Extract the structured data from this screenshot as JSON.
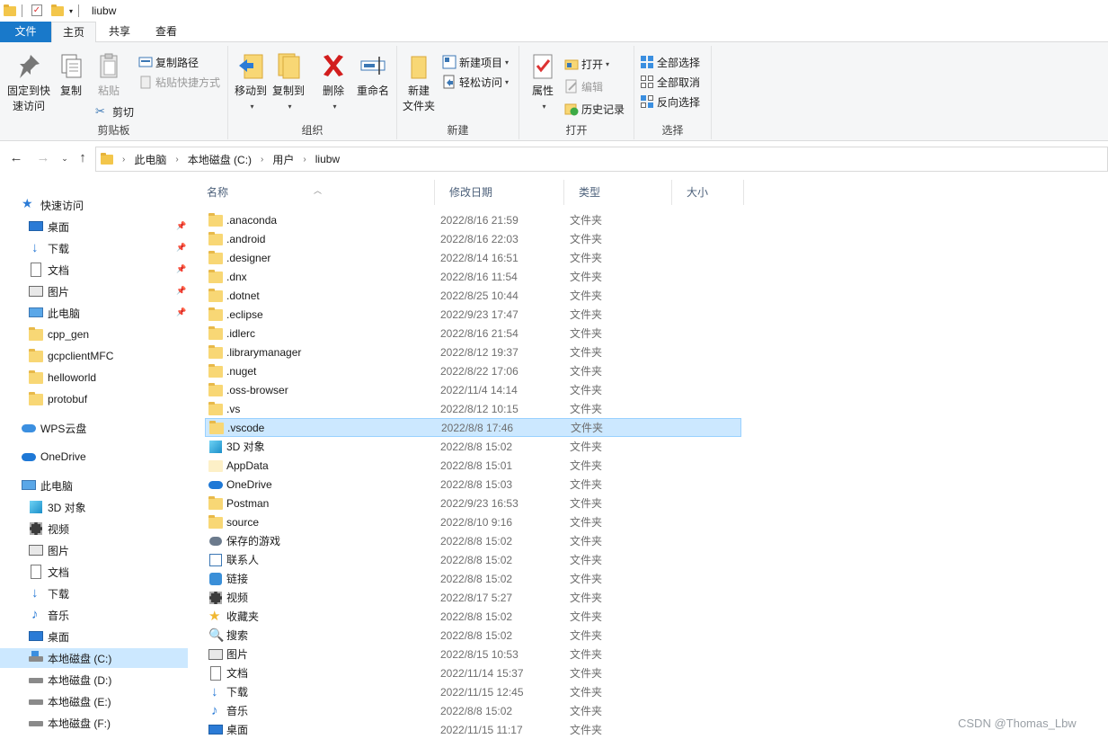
{
  "window": {
    "title": "liubw"
  },
  "tabs": {
    "file": "文件",
    "home": "主页",
    "share": "共享",
    "view": "查看"
  },
  "ribbon": {
    "clipboard": {
      "label": "剪贴板",
      "pin": "固定到快\n速访问",
      "pin_line1": "固定到快",
      "pin_line2": "速访问",
      "copy": "复制",
      "paste": "粘贴",
      "copy_path": "复制路径",
      "paste_shortcut": "粘贴快捷方式",
      "cut": "剪切"
    },
    "organize": {
      "label": "组织",
      "move_to": "移动到",
      "copy_to": "复制到",
      "delete": "删除",
      "rename": "重命名"
    },
    "new": {
      "label": "新建",
      "new_folder_line1": "新建",
      "new_folder_line2": "文件夹",
      "new_item": "新建项目",
      "easy_access": "轻松访问"
    },
    "open": {
      "label": "打开",
      "properties": "属性",
      "open": "打开",
      "edit": "编辑",
      "history": "历史记录"
    },
    "select": {
      "label": "选择",
      "select_all": "全部选择",
      "select_none": "全部取消",
      "invert": "反向选择"
    }
  },
  "address": {
    "crumbs": [
      "此电脑",
      "本地磁盘 (C:)",
      "用户",
      "liubw"
    ]
  },
  "nav": {
    "quick_access": "快速访问",
    "quick_items": [
      "桌面",
      "下载",
      "文档",
      "图片",
      "此电脑",
      "cpp_gen",
      "gcpclientMFC",
      "helloworld",
      "protobuf"
    ],
    "wps": "WPS云盘",
    "onedrive": "OneDrive",
    "this_pc": "此电脑",
    "pc_items": [
      "3D 对象",
      "视频",
      "图片",
      "文档",
      "下载",
      "音乐",
      "桌面",
      "本地磁盘 (C:)",
      "本地磁盘 (D:)",
      "本地磁盘 (E:)",
      "本地磁盘 (F:)"
    ]
  },
  "columns": {
    "name": "名称",
    "date": "修改日期",
    "type": "类型",
    "size": "大小"
  },
  "files": [
    {
      "name": ".anaconda",
      "date": "2022/8/16 21:59",
      "type": "文件夹",
      "icon": "folder-icon"
    },
    {
      "name": ".android",
      "date": "2022/8/16 22:03",
      "type": "文件夹",
      "icon": "folder-icon"
    },
    {
      "name": ".designer",
      "date": "2022/8/14 16:51",
      "type": "文件夹",
      "icon": "folder-icon"
    },
    {
      "name": ".dnx",
      "date": "2022/8/16 11:54",
      "type": "文件夹",
      "icon": "folder-icon"
    },
    {
      "name": ".dotnet",
      "date": "2022/8/25 10:44",
      "type": "文件夹",
      "icon": "folder-icon"
    },
    {
      "name": ".eclipse",
      "date": "2022/9/23 17:47",
      "type": "文件夹",
      "icon": "folder-icon"
    },
    {
      "name": ".idlerc",
      "date": "2022/8/16 21:54",
      "type": "文件夹",
      "icon": "folder-icon"
    },
    {
      "name": ".librarymanager",
      "date": "2022/8/12 19:37",
      "type": "文件夹",
      "icon": "folder-icon"
    },
    {
      "name": ".nuget",
      "date": "2022/8/22 17:06",
      "type": "文件夹",
      "icon": "folder-icon"
    },
    {
      "name": ".oss-browser",
      "date": "2022/11/4 14:14",
      "type": "文件夹",
      "icon": "folder-icon"
    },
    {
      "name": ".vs",
      "date": "2022/8/12 10:15",
      "type": "文件夹",
      "icon": "folder-icon"
    },
    {
      "name": ".vscode",
      "date": "2022/8/8 17:46",
      "type": "文件夹",
      "icon": "folder-icon"
    },
    {
      "name": "3D 对象",
      "date": "2022/8/8 15:02",
      "type": "文件夹",
      "icon": "cube-icon"
    },
    {
      "name": "AppData",
      "date": "2022/8/8 15:01",
      "type": "文件夹",
      "icon": "hidden-folder-icon"
    },
    {
      "name": "OneDrive",
      "date": "2022/8/8 15:03",
      "type": "文件夹",
      "icon": "cloud-icon"
    },
    {
      "name": "Postman",
      "date": "2022/9/23 16:53",
      "type": "文件夹",
      "icon": "folder-icon"
    },
    {
      "name": "source",
      "date": "2022/8/10 9:16",
      "type": "文件夹",
      "icon": "folder-icon"
    },
    {
      "name": "保存的游戏",
      "date": "2022/8/8 15:02",
      "type": "文件夹",
      "icon": "game-icon"
    },
    {
      "name": "联系人",
      "date": "2022/8/8 15:02",
      "type": "文件夹",
      "icon": "contact-icon"
    },
    {
      "name": "链接",
      "date": "2022/8/8 15:02",
      "type": "文件夹",
      "icon": "link-icon"
    },
    {
      "name": "视频",
      "date": "2022/8/17 5:27",
      "type": "文件夹",
      "icon": "film-icon"
    },
    {
      "name": "收藏夹",
      "date": "2022/8/8 15:02",
      "type": "文件夹",
      "icon": "star-icon"
    },
    {
      "name": "搜索",
      "date": "2022/8/8 15:02",
      "type": "文件夹",
      "icon": "search-icon"
    },
    {
      "name": "图片",
      "date": "2022/8/15 10:53",
      "type": "文件夹",
      "icon": "picture-icon"
    },
    {
      "name": "文档",
      "date": "2022/11/14 15:37",
      "type": "文件夹",
      "icon": "document-icon"
    },
    {
      "name": "下载",
      "date": "2022/11/15 12:45",
      "type": "文件夹",
      "icon": "download-icon"
    },
    {
      "name": "音乐",
      "date": "2022/8/8 15:02",
      "type": "文件夹",
      "icon": "music-icon"
    },
    {
      "name": "桌面",
      "date": "2022/11/15 11:17",
      "type": "文件夹",
      "icon": "desktop-icon"
    }
  ],
  "watermark": "CSDN @Thomas_Lbw"
}
